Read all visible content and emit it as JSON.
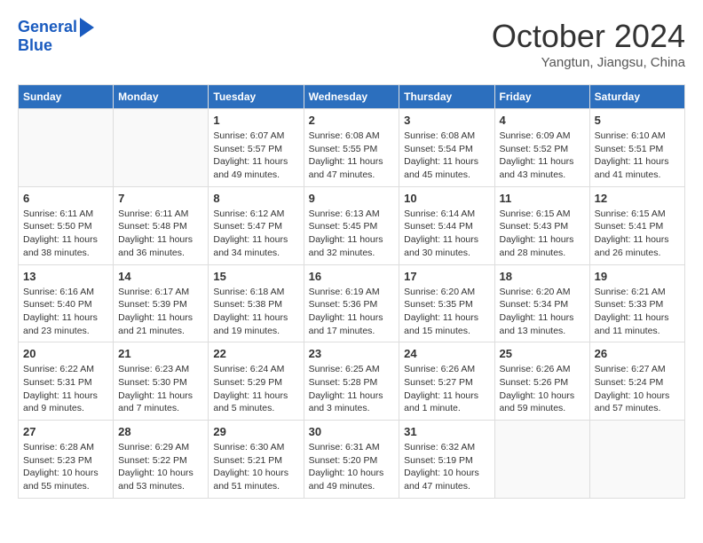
{
  "header": {
    "logo_line1": "General",
    "logo_line2": "Blue",
    "month": "October 2024",
    "location": "Yangtun, Jiangsu, China"
  },
  "weekdays": [
    "Sunday",
    "Monday",
    "Tuesday",
    "Wednesday",
    "Thursday",
    "Friday",
    "Saturday"
  ],
  "weeks": [
    [
      {
        "day": "",
        "info": ""
      },
      {
        "day": "",
        "info": ""
      },
      {
        "day": "1",
        "info": "Sunrise: 6:07 AM\nSunset: 5:57 PM\nDaylight: 11 hours and 49 minutes."
      },
      {
        "day": "2",
        "info": "Sunrise: 6:08 AM\nSunset: 5:55 PM\nDaylight: 11 hours and 47 minutes."
      },
      {
        "day": "3",
        "info": "Sunrise: 6:08 AM\nSunset: 5:54 PM\nDaylight: 11 hours and 45 minutes."
      },
      {
        "day": "4",
        "info": "Sunrise: 6:09 AM\nSunset: 5:52 PM\nDaylight: 11 hours and 43 minutes."
      },
      {
        "day": "5",
        "info": "Sunrise: 6:10 AM\nSunset: 5:51 PM\nDaylight: 11 hours and 41 minutes."
      }
    ],
    [
      {
        "day": "6",
        "info": "Sunrise: 6:11 AM\nSunset: 5:50 PM\nDaylight: 11 hours and 38 minutes."
      },
      {
        "day": "7",
        "info": "Sunrise: 6:11 AM\nSunset: 5:48 PM\nDaylight: 11 hours and 36 minutes."
      },
      {
        "day": "8",
        "info": "Sunrise: 6:12 AM\nSunset: 5:47 PM\nDaylight: 11 hours and 34 minutes."
      },
      {
        "day": "9",
        "info": "Sunrise: 6:13 AM\nSunset: 5:45 PM\nDaylight: 11 hours and 32 minutes."
      },
      {
        "day": "10",
        "info": "Sunrise: 6:14 AM\nSunset: 5:44 PM\nDaylight: 11 hours and 30 minutes."
      },
      {
        "day": "11",
        "info": "Sunrise: 6:15 AM\nSunset: 5:43 PM\nDaylight: 11 hours and 28 minutes."
      },
      {
        "day": "12",
        "info": "Sunrise: 6:15 AM\nSunset: 5:41 PM\nDaylight: 11 hours and 26 minutes."
      }
    ],
    [
      {
        "day": "13",
        "info": "Sunrise: 6:16 AM\nSunset: 5:40 PM\nDaylight: 11 hours and 23 minutes."
      },
      {
        "day": "14",
        "info": "Sunrise: 6:17 AM\nSunset: 5:39 PM\nDaylight: 11 hours and 21 minutes."
      },
      {
        "day": "15",
        "info": "Sunrise: 6:18 AM\nSunset: 5:38 PM\nDaylight: 11 hours and 19 minutes."
      },
      {
        "day": "16",
        "info": "Sunrise: 6:19 AM\nSunset: 5:36 PM\nDaylight: 11 hours and 17 minutes."
      },
      {
        "day": "17",
        "info": "Sunrise: 6:20 AM\nSunset: 5:35 PM\nDaylight: 11 hours and 15 minutes."
      },
      {
        "day": "18",
        "info": "Sunrise: 6:20 AM\nSunset: 5:34 PM\nDaylight: 11 hours and 13 minutes."
      },
      {
        "day": "19",
        "info": "Sunrise: 6:21 AM\nSunset: 5:33 PM\nDaylight: 11 hours and 11 minutes."
      }
    ],
    [
      {
        "day": "20",
        "info": "Sunrise: 6:22 AM\nSunset: 5:31 PM\nDaylight: 11 hours and 9 minutes."
      },
      {
        "day": "21",
        "info": "Sunrise: 6:23 AM\nSunset: 5:30 PM\nDaylight: 11 hours and 7 minutes."
      },
      {
        "day": "22",
        "info": "Sunrise: 6:24 AM\nSunset: 5:29 PM\nDaylight: 11 hours and 5 minutes."
      },
      {
        "day": "23",
        "info": "Sunrise: 6:25 AM\nSunset: 5:28 PM\nDaylight: 11 hours and 3 minutes."
      },
      {
        "day": "24",
        "info": "Sunrise: 6:26 AM\nSunset: 5:27 PM\nDaylight: 11 hours and 1 minute."
      },
      {
        "day": "25",
        "info": "Sunrise: 6:26 AM\nSunset: 5:26 PM\nDaylight: 10 hours and 59 minutes."
      },
      {
        "day": "26",
        "info": "Sunrise: 6:27 AM\nSunset: 5:24 PM\nDaylight: 10 hours and 57 minutes."
      }
    ],
    [
      {
        "day": "27",
        "info": "Sunrise: 6:28 AM\nSunset: 5:23 PM\nDaylight: 10 hours and 55 minutes."
      },
      {
        "day": "28",
        "info": "Sunrise: 6:29 AM\nSunset: 5:22 PM\nDaylight: 10 hours and 53 minutes."
      },
      {
        "day": "29",
        "info": "Sunrise: 6:30 AM\nSunset: 5:21 PM\nDaylight: 10 hours and 51 minutes."
      },
      {
        "day": "30",
        "info": "Sunrise: 6:31 AM\nSunset: 5:20 PM\nDaylight: 10 hours and 49 minutes."
      },
      {
        "day": "31",
        "info": "Sunrise: 6:32 AM\nSunset: 5:19 PM\nDaylight: 10 hours and 47 minutes."
      },
      {
        "day": "",
        "info": ""
      },
      {
        "day": "",
        "info": ""
      }
    ]
  ]
}
